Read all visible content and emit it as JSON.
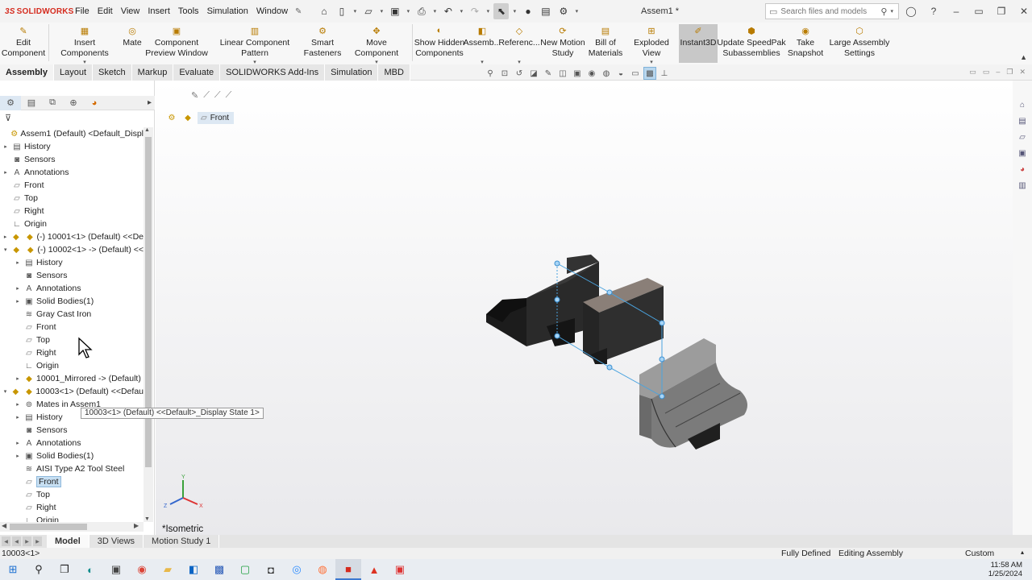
{
  "app": {
    "brand": "SOLIDWORKS",
    "brand_prefix": "3S",
    "document_title": "Assem1 *",
    "accent_color": "#d52b1e"
  },
  "menu": [
    "File",
    "Edit",
    "View",
    "Insert",
    "Tools",
    "Simulation",
    "Window"
  ],
  "search": {
    "placeholder": "Search files and models"
  },
  "commands": [
    {
      "label": "Edit\nComponent",
      "icon": "edit-component-icon"
    },
    {
      "label": "Insert Components",
      "icon": "insert-components-icon",
      "dropdown": true
    },
    {
      "label": "Mate",
      "icon": "mate-icon"
    },
    {
      "label": "Component\nPreview Window",
      "icon": "preview-window-icon"
    },
    {
      "label": "Linear Component Pattern",
      "icon": "linear-pattern-icon",
      "dropdown": true
    },
    {
      "label": "Smart\nFasteners",
      "icon": "smart-fasteners-icon"
    },
    {
      "label": "Move Component",
      "icon": "move-component-icon",
      "dropdown": true
    },
    {
      "label": "Show Hidden\nComponents",
      "icon": "show-hidden-icon"
    },
    {
      "label": "Assemb...",
      "icon": "assembly-features-icon",
      "dropdown": true
    },
    {
      "label": "Referenc...",
      "icon": "reference-geometry-icon",
      "dropdown": true
    },
    {
      "label": "New Motion\nStudy",
      "icon": "motion-study-icon"
    },
    {
      "label": "Bill of\nMaterials",
      "icon": "bom-icon"
    },
    {
      "label": "Exploded View",
      "icon": "exploded-view-icon",
      "dropdown": true
    },
    {
      "label": "Instant3D",
      "icon": "instant3d-icon",
      "active": true
    },
    {
      "label": "Update SpeedPak\nSubassemblies",
      "icon": "speedpak-icon"
    },
    {
      "label": "Take\nSnapshot",
      "icon": "snapshot-icon"
    },
    {
      "label": "Large Assembly\nSettings",
      "icon": "large-assembly-icon"
    }
  ],
  "tabs": [
    "Assembly",
    "Layout",
    "Sketch",
    "Markup",
    "Evaluate",
    "SOLIDWORKS Add-Ins",
    "Simulation",
    "MBD"
  ],
  "active_tab": "Assembly",
  "tree": [
    {
      "label": "Assem1 (Default) <Default_Displ",
      "icon": "assembly-icon",
      "level": 0,
      "toggle": ""
    },
    {
      "label": "History",
      "icon": "history-icon",
      "level": 1,
      "toggle": "▸"
    },
    {
      "label": "Sensors",
      "icon": "sensors-icon",
      "level": 1,
      "toggle": ""
    },
    {
      "label": "Annotations",
      "icon": "annotations-icon",
      "level": 1,
      "toggle": "▸"
    },
    {
      "label": "Front",
      "icon": "plane-icon",
      "level": 1,
      "toggle": ""
    },
    {
      "label": "Top",
      "icon": "plane-icon",
      "level": 1,
      "toggle": ""
    },
    {
      "label": "Right",
      "icon": "plane-icon",
      "level": 1,
      "toggle": ""
    },
    {
      "label": "Origin",
      "icon": "origin-icon",
      "level": 1,
      "toggle": ""
    },
    {
      "label": "(-) 10001<1> (Default) <<De",
      "icon": "part-icon",
      "level": 1,
      "toggle": "▸",
      "two_icons": true
    },
    {
      "label": "(-) 10002<1> -> (Default) <<",
      "icon": "part-icon",
      "level": 1,
      "toggle": "▾",
      "two_icons": true
    },
    {
      "label": "History",
      "icon": "history-icon",
      "level": 2,
      "toggle": "▸"
    },
    {
      "label": "Sensors",
      "icon": "sensors-icon",
      "level": 2,
      "toggle": ""
    },
    {
      "label": "Annotations",
      "icon": "annotations-icon",
      "level": 2,
      "toggle": "▸"
    },
    {
      "label": "Solid Bodies(1)",
      "icon": "solid-bodies-icon",
      "level": 2,
      "toggle": "▸"
    },
    {
      "label": "Gray Cast Iron",
      "icon": "material-icon",
      "level": 2,
      "toggle": ""
    },
    {
      "label": "Front",
      "icon": "plane-icon",
      "level": 2,
      "toggle": ""
    },
    {
      "label": "Top",
      "icon": "plane-icon",
      "level": 2,
      "toggle": ""
    },
    {
      "label": "Right",
      "icon": "plane-icon",
      "level": 2,
      "toggle": ""
    },
    {
      "label": "Origin",
      "icon": "origin-icon",
      "level": 2,
      "toggle": ""
    },
    {
      "label": "10001_Mirrored -> (Default)",
      "icon": "part-icon",
      "level": 2,
      "toggle": "▸"
    },
    {
      "label": "10003<1> (Default) <<Defau",
      "icon": "part-icon",
      "level": 1,
      "toggle": "▾",
      "two_icons": true
    },
    {
      "label": "Mates in Assem1",
      "icon": "mates-icon",
      "level": 2,
      "toggle": "▸"
    },
    {
      "label": "History",
      "icon": "history-icon",
      "level": 2,
      "toggle": "▸"
    },
    {
      "label": "Sensors",
      "icon": "sensors-icon",
      "level": 2,
      "toggle": ""
    },
    {
      "label": "Annotations",
      "icon": "annotations-icon",
      "level": 2,
      "toggle": "▸"
    },
    {
      "label": "Solid Bodies(1)",
      "icon": "solid-bodies-icon",
      "level": 2,
      "toggle": "▸"
    },
    {
      "label": "AISI Type A2 Tool Steel",
      "icon": "material-icon",
      "level": 2,
      "toggle": ""
    },
    {
      "label": "Front",
      "icon": "plane-icon",
      "level": 2,
      "toggle": "",
      "selected": true
    },
    {
      "label": "Top",
      "icon": "plane-icon",
      "level": 2,
      "toggle": ""
    },
    {
      "label": "Right",
      "icon": "plane-icon",
      "level": 2,
      "toggle": ""
    },
    {
      "label": "Origin",
      "icon": "origin-icon",
      "level": 2,
      "toggle": ""
    }
  ],
  "tooltip": "10003<1> (Default) <<Default>_Display State 1>",
  "breadcrumb": {
    "label": "Front"
  },
  "viewport": {
    "view_name": "*Isometric",
    "triad": {
      "x": "X",
      "y": "Y",
      "z": "Z"
    }
  },
  "bottom_tabs": [
    "Model",
    "3D Views",
    "Motion Study 1"
  ],
  "active_bottom_tab": "Model",
  "status": {
    "selection": "10003<1>",
    "definition": "Fully Defined",
    "mode": "Editing Assembly",
    "units": "Custom"
  },
  "clock": {
    "time": "11:58 AM",
    "date": "1/25/2024"
  }
}
